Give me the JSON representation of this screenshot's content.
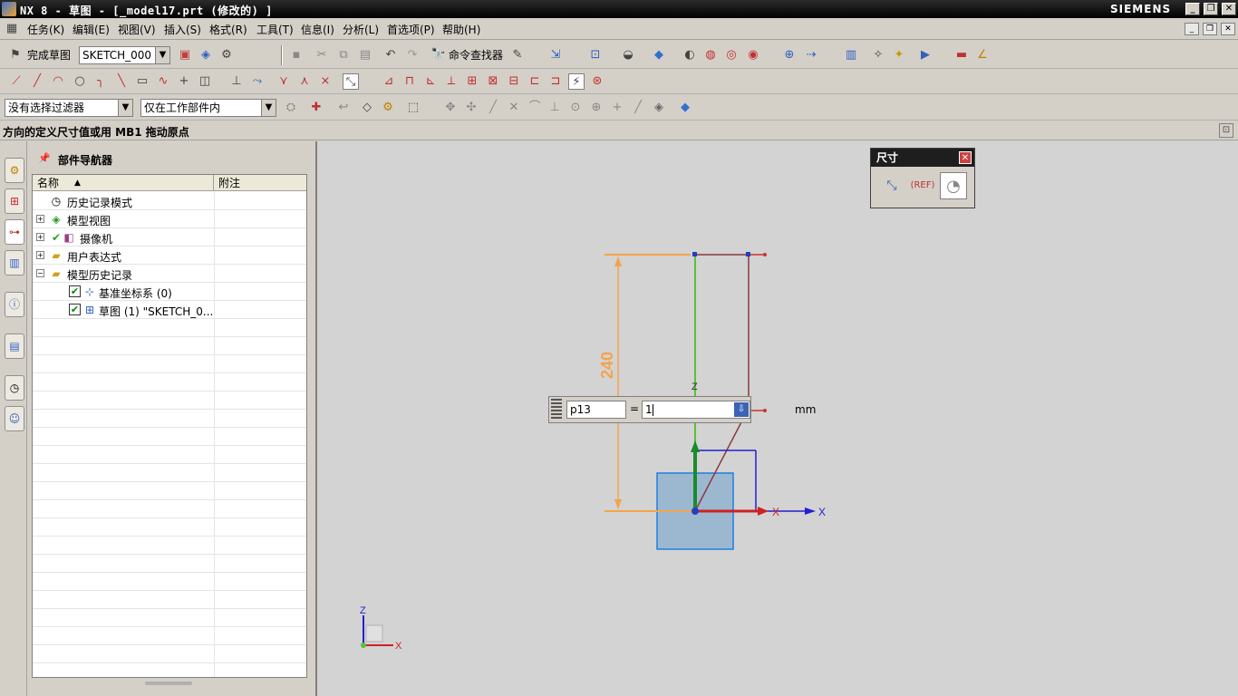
{
  "window": {
    "title": "NX 8 - 草图 - [_model17.prt  (修改的) ]",
    "brand": "SIEMENS"
  },
  "menu": [
    "任务(K)",
    "编辑(E)",
    "视图(V)",
    "插入(S)",
    "格式(R)",
    "工具(T)",
    "信息(I)",
    "分析(L)",
    "首选项(P)",
    "帮助(H)"
  ],
  "toolbar1": {
    "finish_sketch": "完成草图",
    "sketch_name": "SKETCH_000",
    "command_finder": "命令查找器"
  },
  "filterbar": {
    "selection_filter": "没有选择过滤器",
    "scope": "仅在工作部件内"
  },
  "status": {
    "message": "方向的定义尺寸值或用 MB1 拖动原点"
  },
  "navigator": {
    "title": "部件导航器",
    "col_name": "名称",
    "col_comment": "附注",
    "items": [
      {
        "label": "历史记录模式"
      },
      {
        "label": "模型视图"
      },
      {
        "label": "摄像机"
      },
      {
        "label": "用户表达式"
      },
      {
        "label": "模型历史记录"
      },
      {
        "label": "基准坐标系 (0)"
      },
      {
        "label": "草图 (1) \"SKETCH_0..."
      }
    ]
  },
  "dim_panel": {
    "title": "尺寸",
    "ref_label": "(REF)"
  },
  "input": {
    "name": "p13",
    "equals": "=",
    "value": "1",
    "unit": "mm"
  },
  "canvas": {
    "dim_value": "240",
    "axis_z": "Z",
    "axis_x": "X",
    "triad_z": "Z",
    "triad_x": "X"
  },
  "colors": {
    "dimension": "#f5a34a",
    "sketch_curve": "#8b3a3a",
    "y_axis": "#5bc236",
    "datum_axis": "#2020d0",
    "face_fill": "#9cb8d0",
    "background": "#d3d3d3"
  }
}
